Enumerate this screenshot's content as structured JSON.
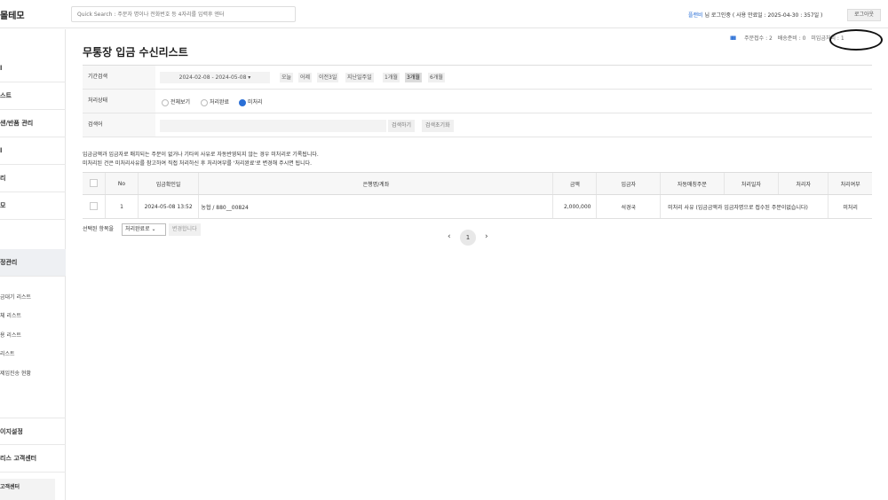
{
  "header": {
    "brand": "몰테모",
    "search_placeholder": "Quick Search : 주문자 명이나 전화번호 등 4자리를 입력후 엔터",
    "plan": "플랜비",
    "user_text": " 님 로그인중 ( 사용 만료일 : 2025-04-30 : 357일 )",
    "logout_label": "로그아웃"
  },
  "sidebar": {
    "items": [
      "l",
      "스트",
      "샌/반품 관리",
      "l",
      "리",
      "모",
      "정관리",
      "이지설정",
      "리스 고객센터"
    ],
    "subitems": [
      "금대기 리스트",
      "체 리스트",
      "용 리스트",
      "리스트",
      "제임진송 현황"
    ],
    "bottom": "고객센터"
  },
  "page": {
    "title": "무통장 입금 수신리스트",
    "status": {
      "bars": "IIIII",
      "order_count": "주문접수 : 2",
      "delivery_ready": "배송준비 : 0",
      "unprocessed": "미입금처리 : 1"
    }
  },
  "filters": {
    "period_label": "기간검색",
    "date_range": "2024-02-08 - 2024-05-08 ▾",
    "quick_ranges": [
      "오늘",
      "어제",
      "이전3일",
      "지난일주일",
      "1개월",
      "3개월",
      "6개월"
    ],
    "selected_range": "3개월",
    "status_label": "처리상태",
    "status_options": [
      "전체보기",
      "처리완료",
      "미처리"
    ],
    "selected_status": "미처리",
    "keyword_label": "검색어",
    "search_button": "검색하기",
    "reset_button": "검색초기화"
  },
  "notice": {
    "line1": "입금금액과 입금자로 매치되는 주문이 없거나 기타의 사유로 자동반영되지 않는 경우 미처리로 기록됩니다.",
    "line2": "미처리된 건은 미처리사유를 참고하여 직접 처리하신 후 처리여부를 '처리완료'로 변경해 주시면 됩니다."
  },
  "table": {
    "columns": [
      "No",
      "입금확인일",
      "은행명/계좌",
      "금액",
      "입금자",
      "자동매칭주문",
      "처리일자",
      "처리자",
      "처리여부"
    ],
    "rows": [
      {
        "no": "1",
        "date": "2024-05-08 13:52",
        "bank": "농협 / 880__00824",
        "amount": "2,000,000",
        "depositor": "석경국",
        "match": "미처리 사유 (입금금액과 입금자명으로 접수된 주문이없습니다)",
        "processed_date": "",
        "processor": "",
        "status": "미처리"
      }
    ]
  },
  "bulk": {
    "label": "선택된 항목을",
    "select_value": "처리완료로 ⌄",
    "apply_button": "변경합니다"
  },
  "pagination": {
    "prev": "‹",
    "current": "1",
    "next": "›"
  }
}
